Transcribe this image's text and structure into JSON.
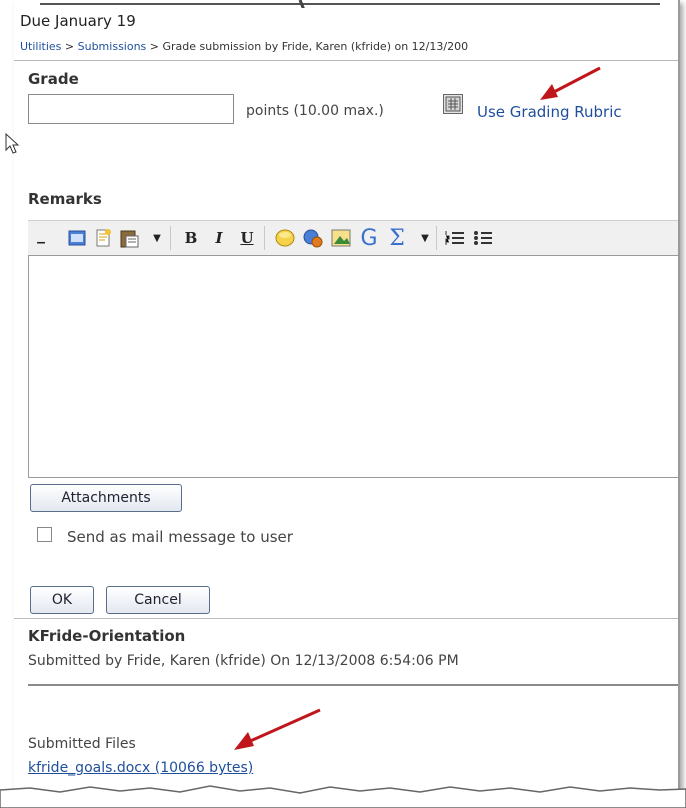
{
  "header": {
    "due": "Due January 19",
    "breadcrumb": {
      "utilities": "Utilities",
      "sep1": ">",
      "submissions": "Submissions",
      "sep2": ">",
      "current": "Grade submission by Fride, Karen (kfride) on 12/13/200"
    }
  },
  "grade": {
    "title": "Grade",
    "input_value": "",
    "points_text": "points (10.00 max.)",
    "rubric_icon": "rubric-icon",
    "rubric_link": "Use Grading Rubric"
  },
  "remarks": {
    "title": "Remarks",
    "toolbar": {
      "bold": "B",
      "italic": "I",
      "underline": "U",
      "sigma": "Σ",
      "google": "G"
    },
    "editor_text": ""
  },
  "attachments_label": "Attachments",
  "send_mail_label": "Send as mail message to user",
  "send_mail_checked": false,
  "ok_label": "OK",
  "cancel_label": "Cancel",
  "submission": {
    "title": "KFride-Orientation",
    "submitted_by": "Submitted by Fride, Karen (kfride) On 12/13/2008 6:54:06 PM",
    "files_label": "Submitted Files",
    "file_link": "kfride_goals.docx (10066 bytes)"
  },
  "colors": {
    "link": "#1f4f9c",
    "arrow": "#c0161b",
    "button_border": "#5a6d8a"
  }
}
